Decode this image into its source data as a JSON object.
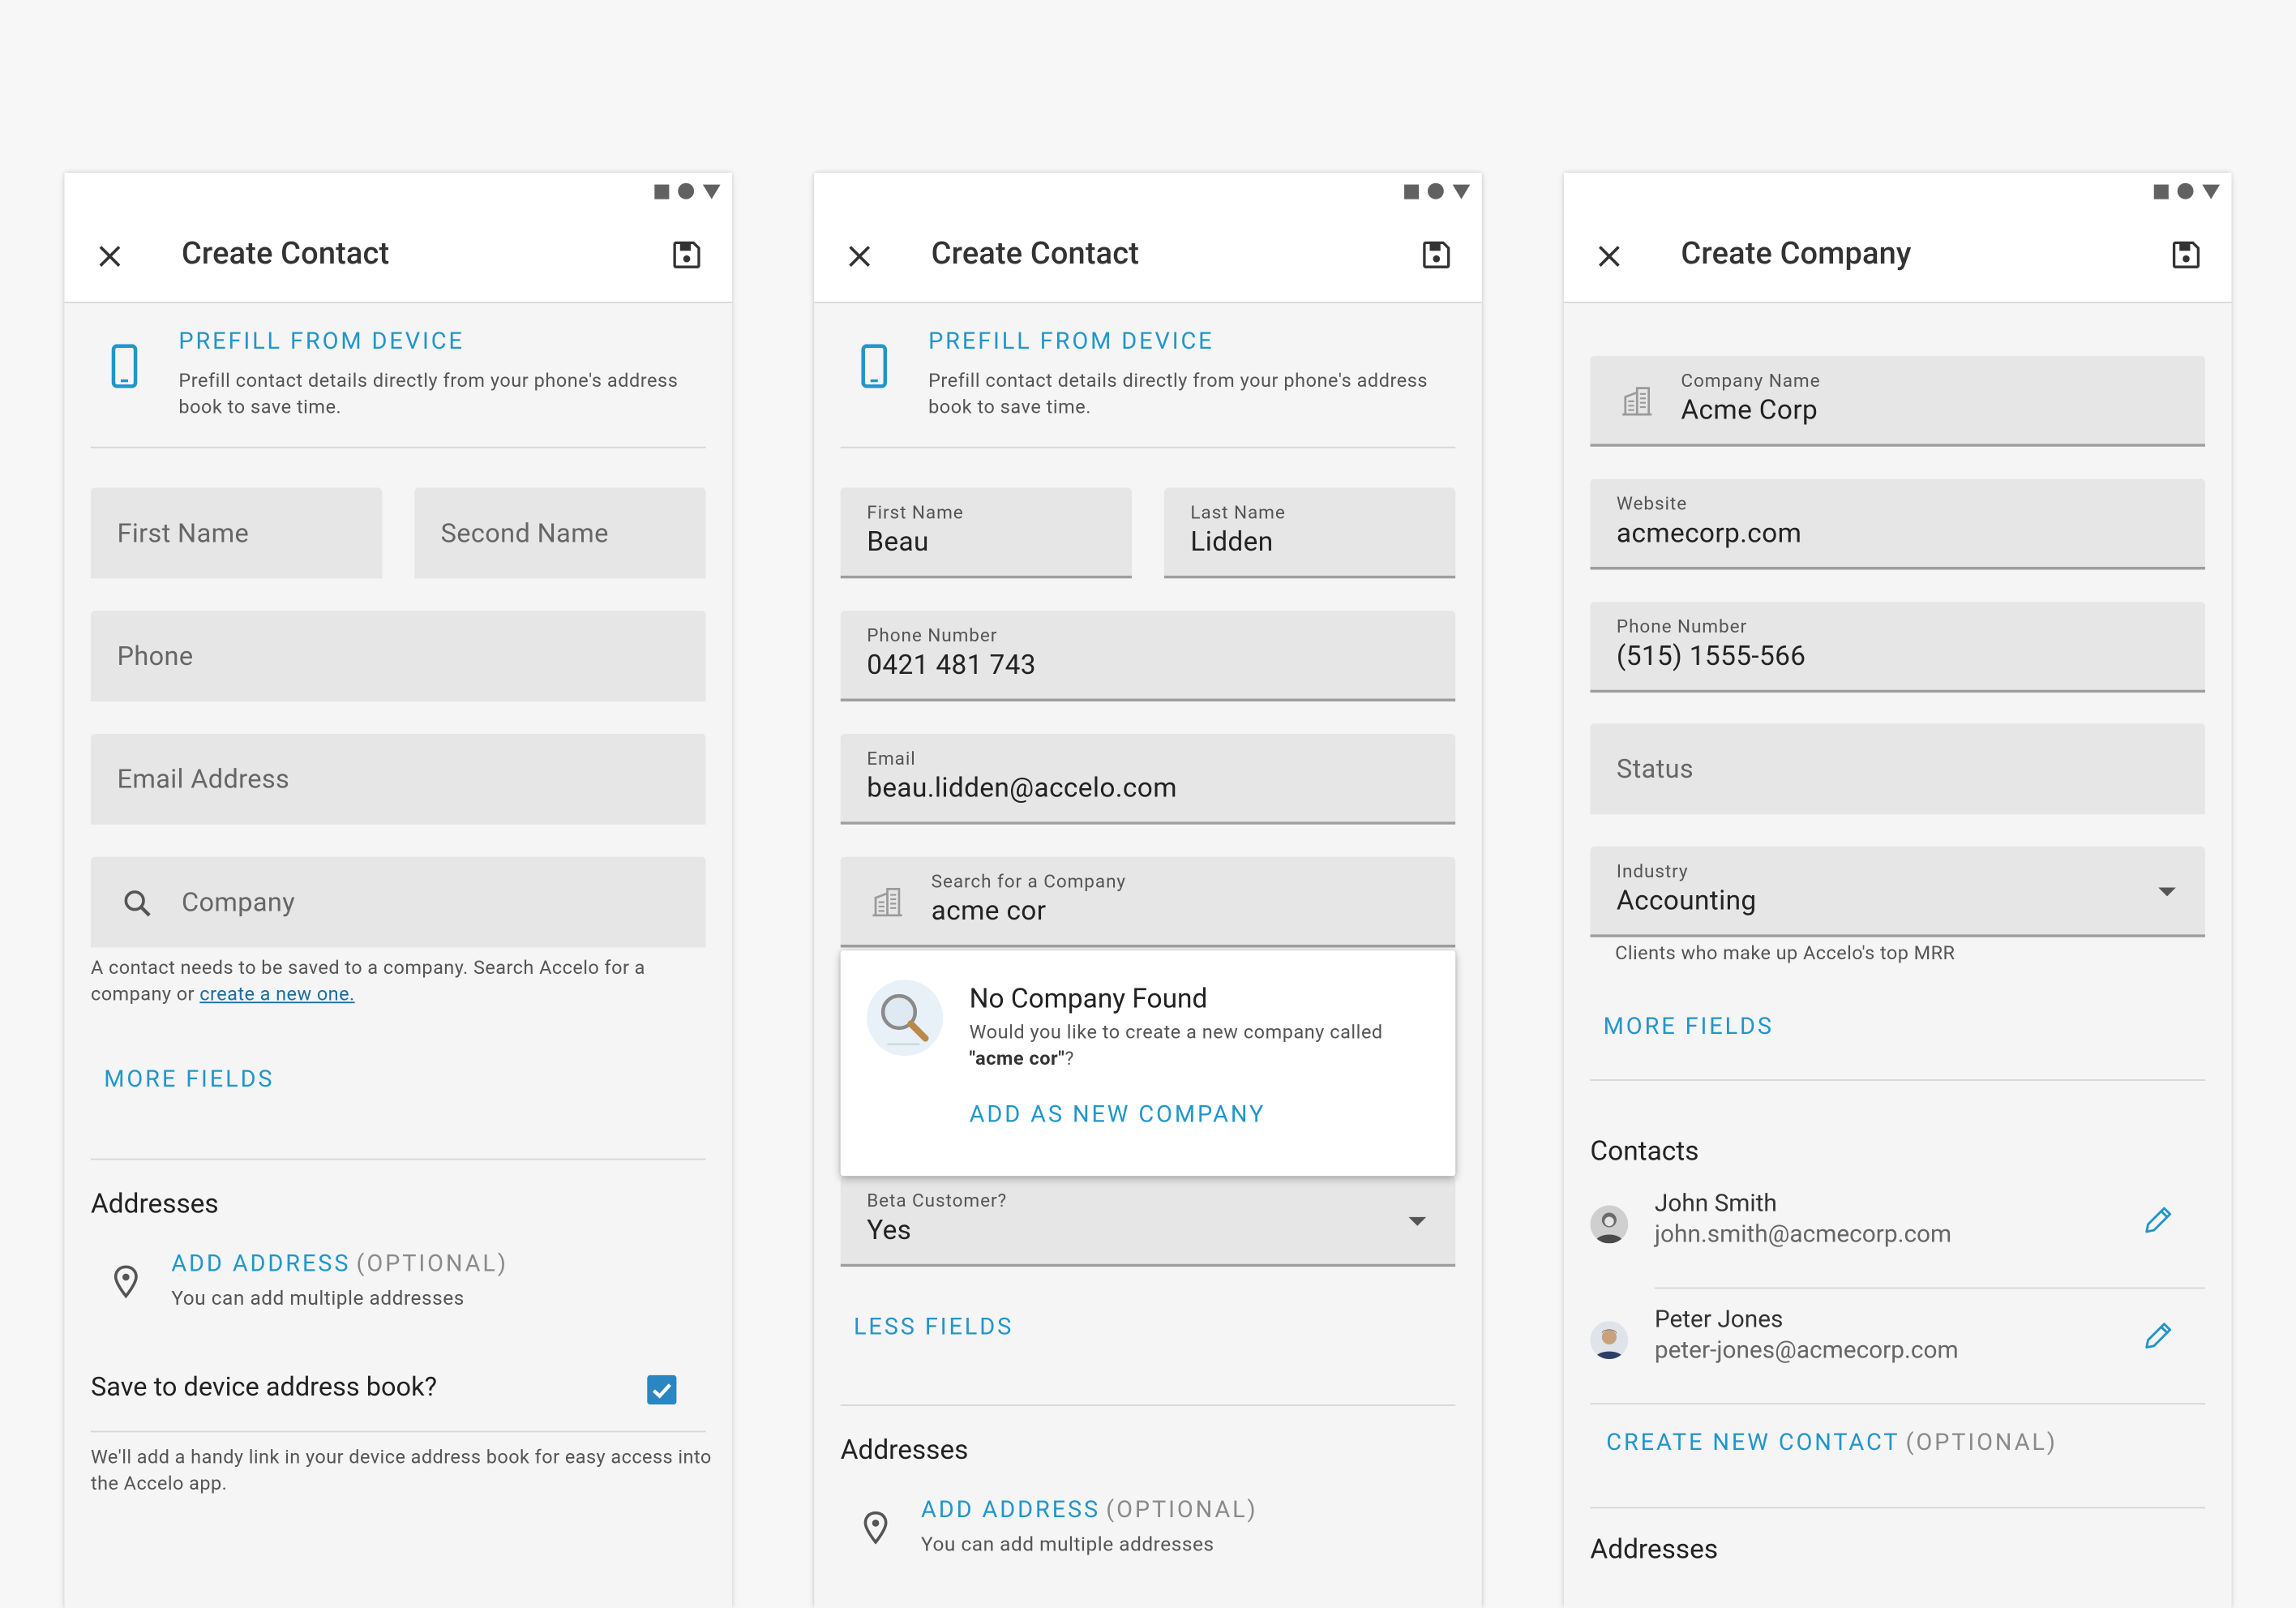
{
  "screen1": {
    "title": "Create Contact",
    "prefill_title": "PREFILL FROM DEVICE",
    "prefill_text": "Prefill contact details directly from your phone's address book to save time.",
    "first_name_placeholder": "First Name",
    "second_name_placeholder": "Second Name",
    "phone_placeholder": "Phone",
    "email_placeholder": "Email Address",
    "company_placeholder": "Company",
    "company_helper": "A contact needs to be saved to a company. Search Accelo for a company or",
    "company_helper_link": "create a new one.",
    "more_fields": "MORE FIELDS",
    "addresses_heading": "Addresses",
    "add_address": "ADD ADDRESS",
    "optional": "(OPTIONAL)",
    "add_address_sub": "You can add multiple addresses",
    "save_to_device": "Save to device address book?",
    "save_to_device_checked": true,
    "save_to_device_helper": "We'll add a handy link in your device address book for easy access into the Accelo app."
  },
  "screen2": {
    "title": "Create Contact",
    "prefill_title": "PREFILL FROM DEVICE",
    "prefill_text": "Prefill contact details directly from your phone's address book to save time.",
    "first_name_label": "First Name",
    "first_name_value": "Beau",
    "last_name_label": "Last Name",
    "last_name_value": "Lidden",
    "phone_label": "Phone Number",
    "phone_value": "0421 481 743",
    "email_label": "Email",
    "email_value": "beau.lidden@accelo.com",
    "company_label": "Search for a Company",
    "company_value": "acme cor",
    "popup_title": "No Company Found",
    "popup_text_prefix": "Would you like to create a new company called",
    "popup_query": "\"acme cor\"",
    "popup_text_suffix": "?",
    "popup_action": "ADD AS NEW COMPANY",
    "beta_label": "Beta Customer?",
    "beta_value": "Yes",
    "less_fields": "LESS FIELDS",
    "addresses_heading": "Addresses",
    "add_address": "ADD ADDRESS",
    "optional": "(OPTIONAL)",
    "add_address_sub": "You can add multiple addresses"
  },
  "screen3": {
    "title": "Create Company",
    "company_name_label": "Company Name",
    "company_name_value": "Acme Corp",
    "website_label": "Website",
    "website_value": "acmecorp.com",
    "phone_label": "Phone Number",
    "phone_value": "(515) 1555-566",
    "status_placeholder": "Status",
    "industry_label": "Industry",
    "industry_value": "Accounting",
    "industry_helper": "Clients who make up Accelo's top MRR",
    "more_fields": "MORE FIELDS",
    "contacts_heading": "Contacts",
    "contacts": [
      {
        "name": "John Smith",
        "email": "john.smith@acmecorp.com"
      },
      {
        "name": "Peter Jones",
        "email": "peter-jones@acmecorp.com"
      }
    ],
    "create_new_contact": "CREATE NEW CONTACT",
    "optional": "(OPTIONAL)",
    "addresses_heading": "Addresses"
  },
  "colors": {
    "accent": "#2196c9",
    "checkbox": "#2a86c2",
    "field_bg": "#e6e6e6",
    "page_bg": "#f7f7f7"
  }
}
